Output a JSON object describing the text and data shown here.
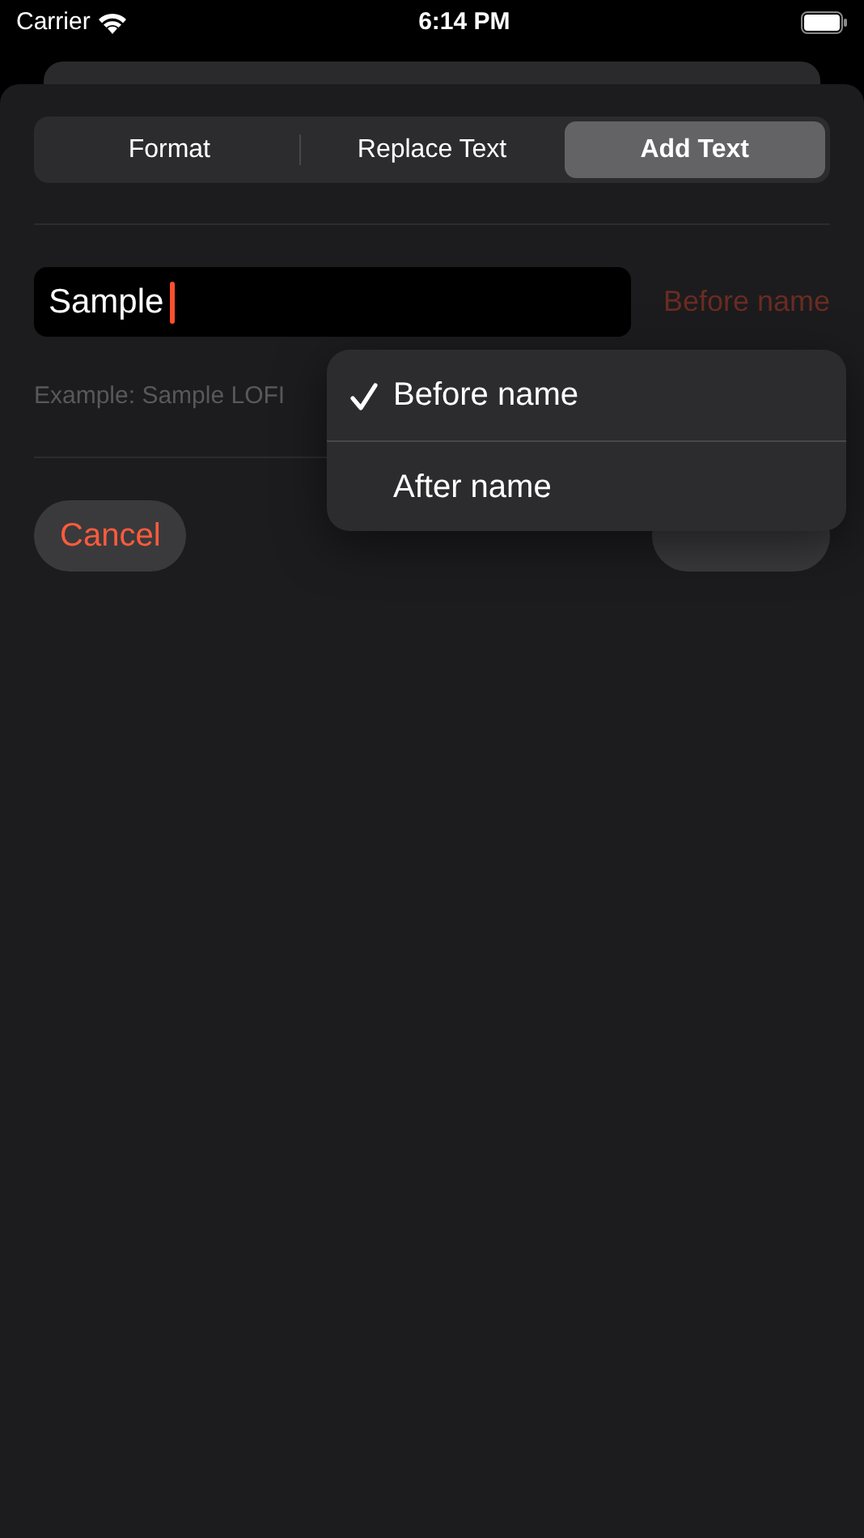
{
  "status_bar": {
    "carrier": "Carrier",
    "time": "6:14 PM"
  },
  "tabs": [
    {
      "label": "Format",
      "selected": false
    },
    {
      "label": "Replace Text",
      "selected": false
    },
    {
      "label": "Add Text",
      "selected": true
    }
  ],
  "name_field": {
    "value": "Sample",
    "position_button": "Before name"
  },
  "example": "Example: Sample LOFI",
  "buttons": [
    {
      "label": "Cancel",
      "kind": "cancel"
    },
    {
      "kind": "rename"
    }
  ],
  "menu": {
    "items": [
      {
        "label": "Before name",
        "selected": true
      },
      {
        "label": "After name",
        "selected": false
      }
    ]
  }
}
